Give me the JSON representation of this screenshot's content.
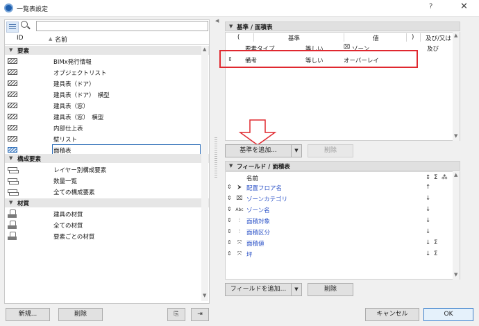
{
  "window": {
    "title": "一覧表設定",
    "help_label": "?",
    "close_label": "✕"
  },
  "left": {
    "search": {
      "value": "",
      "placeholder": ""
    },
    "columns": {
      "id": "ID",
      "name": "名前"
    },
    "groups": [
      {
        "label": "要素",
        "items": [
          {
            "name": "BIMx発行情報",
            "icon": "schedule-icon"
          },
          {
            "name": "オブジェクトリスト",
            "icon": "schedule-icon"
          },
          {
            "name": "建具表（ドア）",
            "icon": "schedule-icon"
          },
          {
            "name": "建具表（ドア）　横型",
            "icon": "schedule-icon"
          },
          {
            "name": "建具表（窓）",
            "icon": "schedule-icon"
          },
          {
            "name": "建具表（窓）　横型",
            "icon": "schedule-icon"
          },
          {
            "name": "内部仕上表",
            "icon": "schedule-icon"
          },
          {
            "name": "壁リスト",
            "icon": "schedule-icon"
          },
          {
            "name": "面積表",
            "icon": "schedule-icon",
            "selected": true
          }
        ]
      },
      {
        "label": "構成要素",
        "items": [
          {
            "name": "レイヤー別構成要素",
            "icon": "layer-icon"
          },
          {
            "name": "数量一覧",
            "icon": "layer-icon"
          },
          {
            "name": "全ての構成要素",
            "icon": "layer-icon"
          }
        ]
      },
      {
        "label": "材質",
        "items": [
          {
            "name": "建具の材質",
            "icon": "material-icon"
          },
          {
            "name": "全ての材質",
            "icon": "material-icon"
          },
          {
            "name": "要素ごとの材質",
            "icon": "material-icon"
          }
        ]
      }
    ],
    "buttons": {
      "new": "新規...",
      "delete": "削除"
    }
  },
  "criteria": {
    "header": "基準 /  面積表",
    "columns": {
      "paren_open": "(",
      "criterion": "基準",
      "value": "値",
      "paren_close": ")",
      "andor": "及び/又は"
    },
    "rows": [
      {
        "criterion": "要素タイプ",
        "op": "等しい",
        "value": "ゾーン",
        "andor": "及び"
      },
      {
        "criterion": "備考",
        "op": "等しい",
        "value": "オーバーレイ",
        "andor": ""
      }
    ],
    "add_button": "基準を追加...",
    "delete_button": "削除"
  },
  "fields": {
    "header": "フィールド /  面積表",
    "name_column": "名前",
    "col_sort": "↕",
    "col_sum": "Σ",
    "rows": [
      {
        "name": "配置フロア名",
        "sort": "↑",
        "sum": "",
        "icon": "cursor-icon"
      },
      {
        "name": "ゾーンカテゴリ",
        "sort": "↓",
        "sum": "",
        "icon": "zone-icon"
      },
      {
        "name": "ゾーン名",
        "sort": "↓",
        "sum": "",
        "icon": "text-icon"
      },
      {
        "name": "面積対象",
        "sort": "↓",
        "sum": "",
        "icon": "bars-icon"
      },
      {
        "name": "面積区分",
        "sort": "↓",
        "sum": "",
        "icon": "bars-icon"
      },
      {
        "name": "面積値",
        "sort": "↓",
        "sum": "Σ",
        "icon": "dimension-icon"
      },
      {
        "name": "坪",
        "sort": "↓",
        "sum": "Σ",
        "icon": "dimension-icon"
      }
    ],
    "add_button": "フィールドを追加...",
    "delete_button": "削除"
  },
  "footer": {
    "cancel": "キャンセル",
    "ok": "OK"
  },
  "colors": {
    "highlight": "#e0282f",
    "link": "#2f55c8",
    "selection": "#2f6fb8"
  }
}
